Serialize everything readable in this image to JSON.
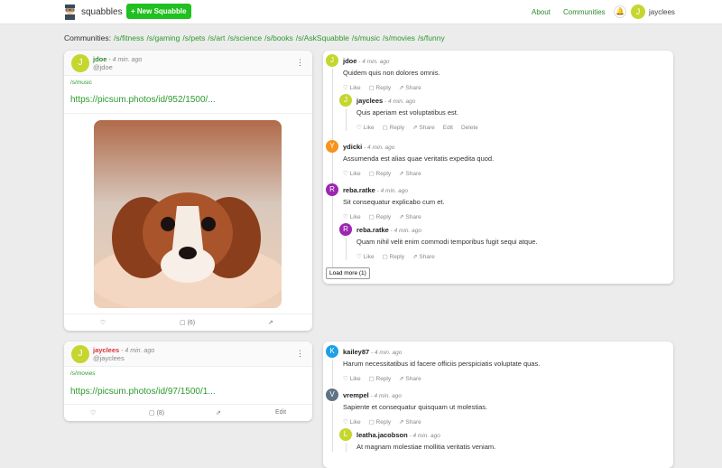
{
  "header": {
    "brand": "squabbles",
    "new_button": "+ New Squabble",
    "nav": [
      "About",
      "Communities"
    ],
    "user_initial": "J",
    "username": "jayclees"
  },
  "communities": {
    "label": "Communities:",
    "items": [
      "/s/fitness",
      "/s/gaming",
      "/s/pets",
      "/s/art",
      "/s/science",
      "/s/books",
      "/s/AskSquabble",
      "/s/music",
      "/s/movies",
      "/s/funny"
    ]
  },
  "colors": {
    "accent": "#1fc01f",
    "link": "#2e9a2e"
  },
  "posts": [
    {
      "initial": "J",
      "author": "jdoe",
      "time": " - 4 min. ago",
      "handle": "@jdoe",
      "community": "/s/music",
      "link": "https://picsum.photos/id/952/1500/...",
      "comments": "(6)"
    },
    {
      "initial": "J",
      "author": "jayclees",
      "time": " - 4 min. ago",
      "handle": "@jayclees",
      "community": "/s/movies",
      "link": "https://picsum.photos/id/97/1500/1...",
      "comments": "(8)",
      "edit": "Edit"
    }
  ],
  "actions": {
    "like": "♡ Like",
    "reply": "▢ Reply",
    "share": "⇗ Share",
    "edit": "Edit",
    "delete": "Delete"
  },
  "threads": [
    [
      {
        "initial": "J",
        "color": "#c5d62e",
        "user": "jdoe",
        "time": " - 4 min. ago",
        "text": "Quidem quis non dolores omnis."
      },
      {
        "initial": "J",
        "color": "#c5d62e",
        "user": "jayclees",
        "time": " - 4 min. ago",
        "text": "Quis aperiam est voluptatibus est."
      },
      {
        "initial": "Y",
        "color": "#f7931e",
        "user": "ydicki",
        "time": " - 4 min. ago",
        "text": "Assumenda est alias quae veritatis expedita quod."
      },
      {
        "initial": "R",
        "color": "#9c27b0",
        "user": "reba.ratke",
        "time": " - 4 min. ago",
        "text": "Sit consequatur explicabo cum et."
      },
      {
        "initial": "R",
        "color": "#9c27b0",
        "user": "reba.ratke",
        "time": " - 4 min. ago",
        "text": "Quam nihil velit enim commodi temporibus fugit sequi atque."
      }
    ],
    [
      {
        "initial": "K",
        "color": "#1ea0e6",
        "user": "kailey87",
        "time": " - 4 min. ago",
        "text": "Harum necessitatibus id facere officiis perspiciatis voluptate quas."
      },
      {
        "initial": "V",
        "color": "#5f7384",
        "user": "vrempel",
        "time": " - 4 min. ago",
        "text": "Sapiente et consequatur quisquam ut molestias."
      },
      {
        "initial": "L",
        "color": "#c5d62e",
        "user": "leatha.jacobson",
        "time": " - 4 min. ago",
        "text": "At magnam molestiae mollitia veritatis veniam."
      }
    ]
  ],
  "load_more": "Load more (1)"
}
